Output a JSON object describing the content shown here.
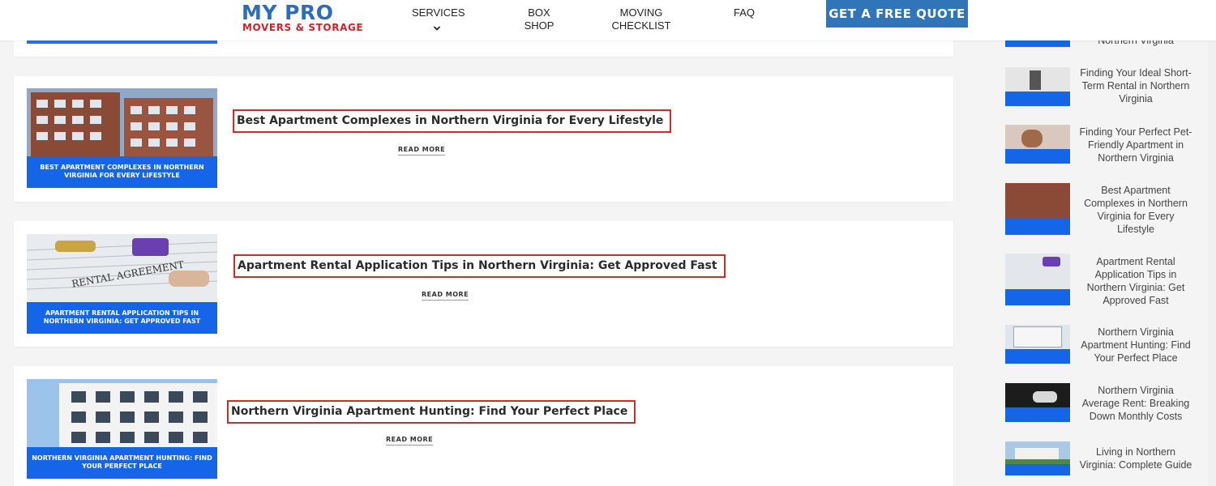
{
  "header": {
    "logo_main": "MY PRO",
    "logo_sub": "MOVERS & STORAGE",
    "nav": [
      {
        "label": "SERVICES"
      },
      {
        "label": "BOX SHOP"
      },
      {
        "label": "MOVING CHECKLIST"
      },
      {
        "label": "FAQ"
      }
    ],
    "quote_button": "GET A FREE QUOTE"
  },
  "posts": [
    {
      "title": "Best Apartment Complexes in Northern Virginia for Every Lifestyle",
      "image_caption": "BEST APARTMENT COMPLEXES IN NORTHERN VIRGINIA FOR EVERY LIFESTYLE",
      "read_more": "READ MORE"
    },
    {
      "title": "Apartment Rental Application Tips in Northern Virginia: Get Approved Fast",
      "image_caption": "APARTMENT RENTAL APPLICATION TIPS IN NORTHERN VIRGINIA: GET APPROVED FAST",
      "read_more": "READ MORE"
    },
    {
      "title": "Northern Virginia Apartment Hunting: Find Your Perfect Place",
      "image_caption": "NORTHERN VIRGINIA APARTMENT HUNTING: FIND YOUR PERFECT PLACE",
      "read_more": "READ MORE"
    }
  ],
  "sidebar": {
    "items": [
      {
        "title": "Northern Virginia"
      },
      {
        "title": "Finding Your Ideal Short-Term Rental in Northern Virginia"
      },
      {
        "title": "Finding Your Perfect Pet-Friendly Apartment in Northern Virginia"
      },
      {
        "title": "Best Apartment Complexes in Northern Virginia for Every Lifestyle"
      },
      {
        "title": "Apartment Rental Application Tips in Northern Virginia: Get Approved Fast"
      },
      {
        "title": "Northern Virginia Apartment Hunting: Find Your Perfect Place"
      },
      {
        "title": "Northern Virginia Average Rent: Breaking Down Monthly Costs"
      },
      {
        "title": "Living in Northern Virginia: Complete Guide"
      }
    ]
  },
  "colors": {
    "brand_blue": "#2f6db6",
    "brand_red": "#d0222a",
    "quote_button_bg": "#2f75b8",
    "title_outline": "#d22a2a"
  }
}
